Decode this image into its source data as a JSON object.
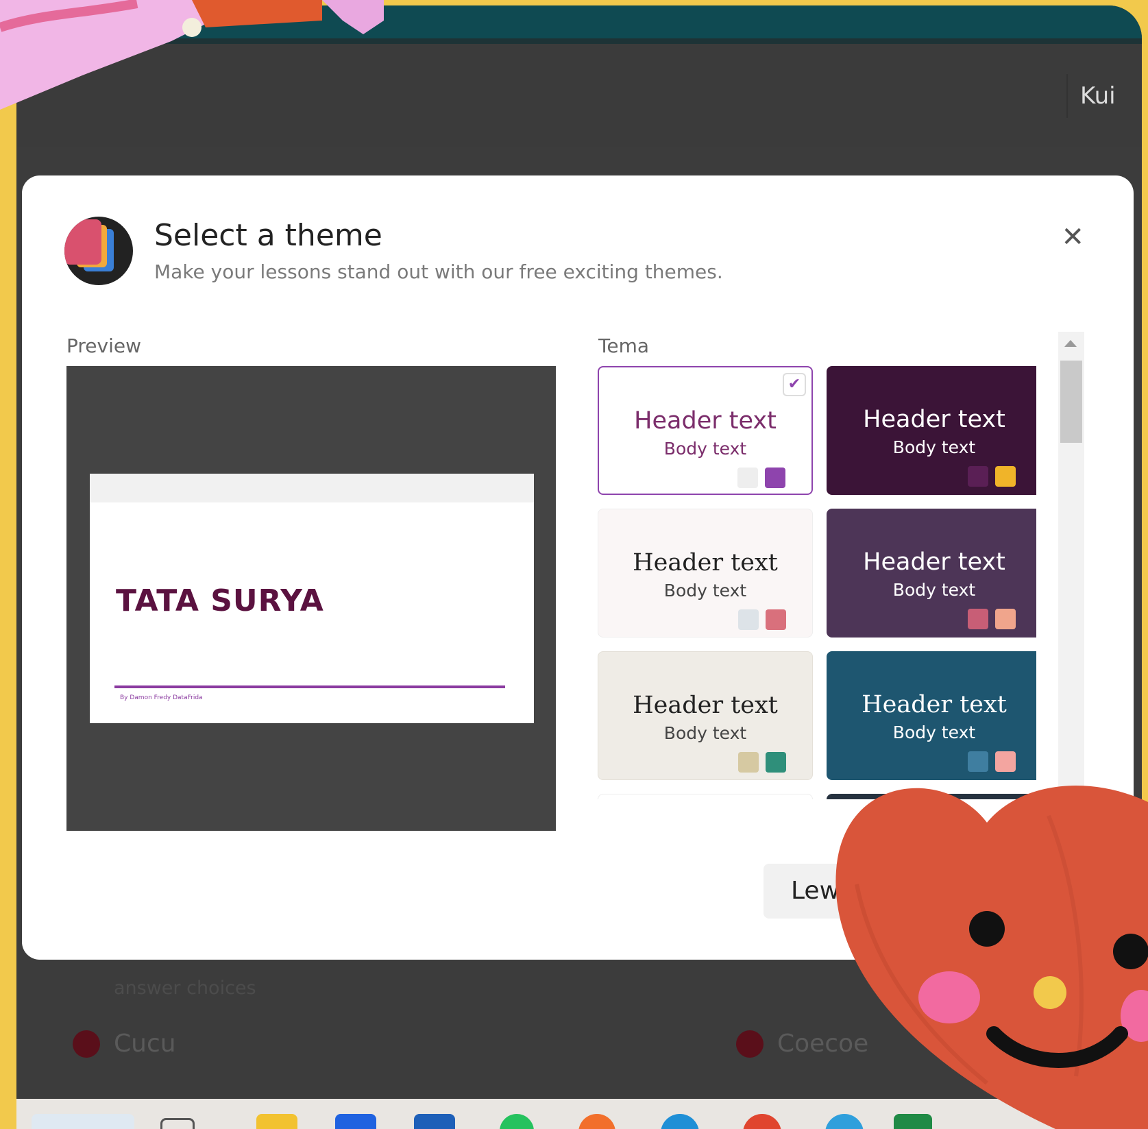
{
  "app": {
    "top_right_label": "Kui",
    "answer_section_label": "answer choices",
    "answers": [
      "Cucu",
      "Coecoe"
    ]
  },
  "modal": {
    "title": "Select a theme",
    "subtitle": "Make your lessons stand out with our free exciting themes.",
    "close_icon": "close-icon",
    "preview_label": "Preview",
    "theme_label": "Tema",
    "preview": {
      "slide_title": "TATA SURYA",
      "slide_author": "By Damon Fredy DataFrida"
    },
    "themes": [
      {
        "header": "Header text",
        "body": "Body text",
        "bg": "#ffffff",
        "header_color": "#7b2d6b",
        "body_color": "#7b2d6b",
        "swatches": [
          "#eeeeee",
          "#8e44ad"
        ],
        "selected": true
      },
      {
        "header": "Header text",
        "body": "Body text",
        "bg": "#3b1437",
        "header_color": "#ffffff",
        "body_color": "#ffffff",
        "swatches": [
          "#5a1f55",
          "#f0b429"
        ],
        "selected": false
      },
      {
        "header": "Header text",
        "body": "Body text",
        "bg": "#faf6f6",
        "header_color": "#222222",
        "body_color": "#444444",
        "swatches": [
          "#dde3e8",
          "#d9707c"
        ],
        "selected": false
      },
      {
        "header": "Header text",
        "body": "Body text",
        "bg": "#4d3557",
        "header_color": "#ffffff",
        "body_color": "#ffffff",
        "swatches": [
          "#c85e76",
          "#f0a58c"
        ],
        "selected": false
      },
      {
        "header": "Header text",
        "body": "Body text",
        "bg": "#efece6",
        "header_color": "#222222",
        "body_color": "#444444",
        "swatches": [
          "#d6c9a2",
          "#2f8f7a"
        ],
        "selected": false
      },
      {
        "header": "Header text",
        "body": "Body text",
        "bg": "#1e5670",
        "header_color": "#ffffff",
        "body_color": "#ffffff",
        "swatches": [
          "#3f7ea0",
          "#f3a5a0"
        ],
        "selected": false
      }
    ],
    "next_button": "Lew"
  },
  "colors": {
    "frame": "#f2c94c",
    "topbar": "#0f4a52",
    "accent": "#8e44ad"
  }
}
